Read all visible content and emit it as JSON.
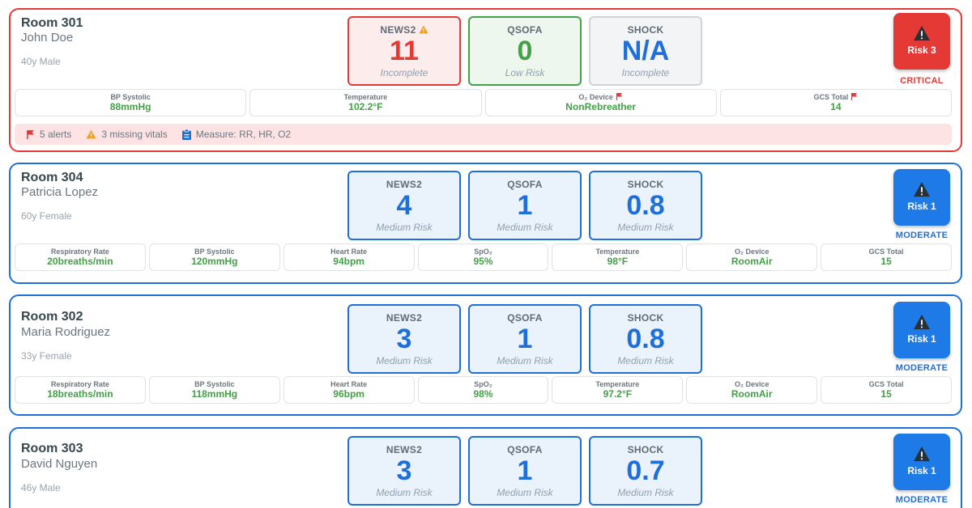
{
  "colors": {
    "critical": "#e53935",
    "moderate": "#1e6fd9",
    "normal_value": "#43a047"
  },
  "cards": [
    {
      "room": "Room 301",
      "name": "John Doe",
      "demo": "40y Male",
      "news2": {
        "label": "NEWS2",
        "value": "11",
        "sub": "Incomplete",
        "icon": "warning-icon"
      },
      "qsofa": {
        "label": "QSOFA",
        "value": "0",
        "sub": "Low Risk"
      },
      "shock": {
        "label": "SHOCK",
        "value": "N/A",
        "sub": "Incomplete"
      },
      "risk": {
        "label": "Risk 3",
        "level": "CRITICAL",
        "icon": "warning-icon"
      },
      "vitals": [
        {
          "label": "BP Systolic",
          "value": "88mmHg"
        },
        {
          "label": "Temperature",
          "value": "102.2°F"
        },
        {
          "label": "O₂ Device",
          "value": "NonRebreather",
          "flag": "flag-icon"
        },
        {
          "label": "GCS Total",
          "value": "14",
          "flag": "flag-icon"
        }
      ],
      "alerts": {
        "alerts": "5 alerts",
        "missing": "3 missing vitals",
        "measure": "Measure: RR, HR, O2"
      }
    },
    {
      "room": "Room 304",
      "name": "Patricia Lopez",
      "demo": "60y Female",
      "news2": {
        "label": "NEWS2",
        "value": "4",
        "sub": "Medium Risk"
      },
      "qsofa": {
        "label": "QSOFA",
        "value": "1",
        "sub": "Medium Risk"
      },
      "shock": {
        "label": "SHOCK",
        "value": "0.8",
        "sub": "Medium Risk"
      },
      "risk": {
        "label": "Risk 1",
        "level": "MODERATE"
      },
      "vitals": [
        {
          "label": "Respiratory Rate",
          "value": "20breaths/min"
        },
        {
          "label": "BP Systolic",
          "value": "120mmHg"
        },
        {
          "label": "Heart Rate",
          "value": "94bpm"
        },
        {
          "label": "SpO₂",
          "value": "95%"
        },
        {
          "label": "Temperature",
          "value": "98°F"
        },
        {
          "label": "O₂ Device",
          "value": "RoomAir"
        },
        {
          "label": "GCS Total",
          "value": "15"
        }
      ]
    },
    {
      "room": "Room 302",
      "name": "Maria Rodriguez",
      "demo": "33y Female",
      "news2": {
        "label": "NEWS2",
        "value": "3",
        "sub": "Medium Risk"
      },
      "qsofa": {
        "label": "QSOFA",
        "value": "1",
        "sub": "Medium Risk"
      },
      "shock": {
        "label": "SHOCK",
        "value": "0.8",
        "sub": "Medium Risk"
      },
      "risk": {
        "label": "Risk 1",
        "level": "MODERATE"
      },
      "vitals": [
        {
          "label": "Respiratory Rate",
          "value": "18breaths/min"
        },
        {
          "label": "BP Systolic",
          "value": "118mmHg"
        },
        {
          "label": "Heart Rate",
          "value": "96bpm"
        },
        {
          "label": "SpO₂",
          "value": "98%"
        },
        {
          "label": "Temperature",
          "value": "97.2°F"
        },
        {
          "label": "O₂ Device",
          "value": "RoomAir"
        },
        {
          "label": "GCS Total",
          "value": "15"
        }
      ]
    },
    {
      "room": "Room 303",
      "name": "David Nguyen",
      "demo": "46y Male",
      "news2": {
        "label": "NEWS2",
        "value": "3",
        "sub": "Medium Risk"
      },
      "qsofa": {
        "label": "QSOFA",
        "value": "1",
        "sub": "Medium Risk"
      },
      "shock": {
        "label": "SHOCK",
        "value": "0.7",
        "sub": "Medium Risk"
      },
      "risk": {
        "label": "Risk 1",
        "level": "MODERATE"
      }
    }
  ]
}
